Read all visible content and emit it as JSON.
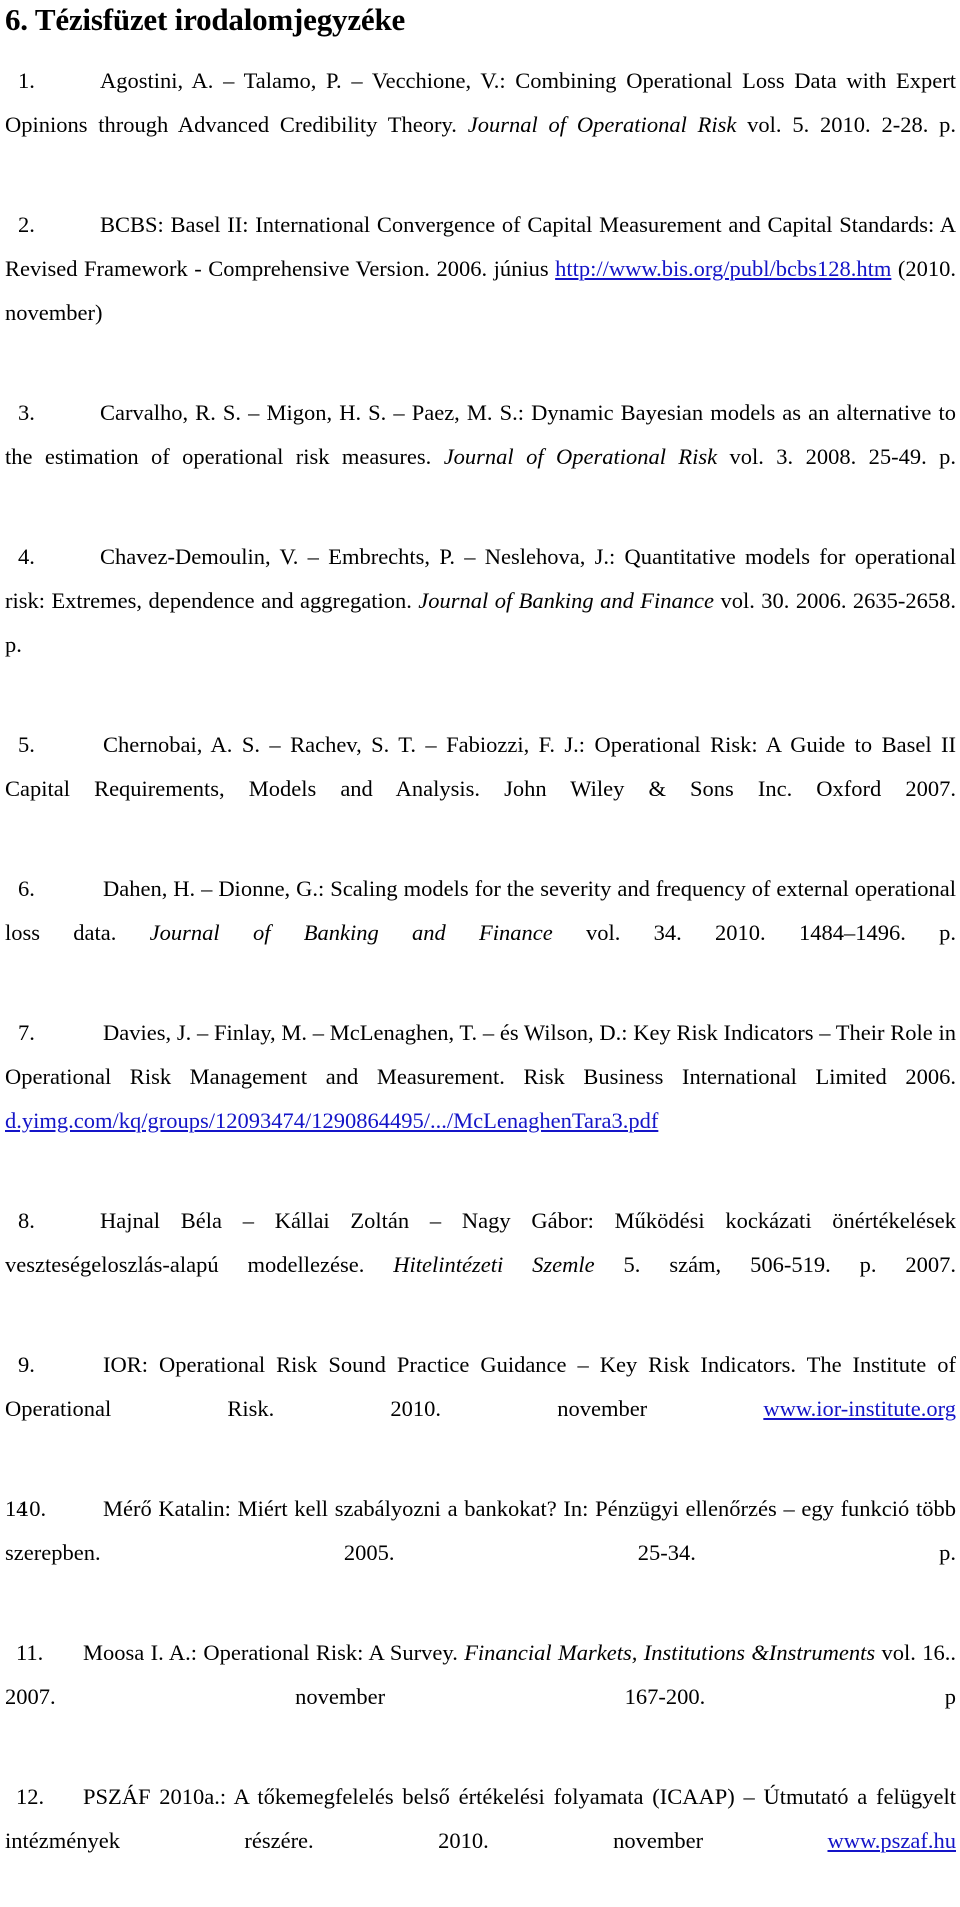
{
  "document": {
    "title": "6. Tézisfüzet irodalomjegyzéke",
    "page_number": "14",
    "link_color": "#1414c8",
    "text_color": "#000000",
    "background_color": "#ffffff"
  },
  "references": [
    {
      "marker": "1.",
      "parts": [
        {
          "type": "text",
          "text": "Agostini, A. – Talamo, P. – Vecchione, V.: Combining Operational Loss Data with Expert Opinions through Advanced Credibility Theory. "
        },
        {
          "type": "italic",
          "text": "Journal of Operational Risk"
        },
        {
          "type": "text",
          "text": " vol. 5. 2010. 2-28. p."
        }
      ],
      "plain": "Agostini, A. – Talamo, P. – Vecchione, V.: Combining Operational Loss Data with Expert Opinions through Advanced Credibility Theory. Journal of Operational Risk vol. 5. 2010. 2-28. p."
    },
    {
      "marker": "2.",
      "parts": [
        {
          "type": "text",
          "text": "BCBS: Basel II: International Convergence of Capital Measurement and Capital Standards: A Revised Framework - Comprehensive Version. 2006. június "
        },
        {
          "type": "link",
          "text": "http://www.bis.org/publ/bcbs128.htm"
        },
        {
          "type": "text",
          "text": " (2010. november)"
        }
      ],
      "plain": "BCBS: Basel II: International Convergence of Capital Measurement and Capital Standards: A Revised Framework - Comprehensive Version. 2006. június http://www.bis.org/publ/bcbs128.htm (2010. november)"
    },
    {
      "marker": "3.",
      "parts": [
        {
          "type": "text",
          "text": "Carvalho, R. S. – Migon, H. S. – Paez, M. S.: Dynamic Bayesian models as an alternative to the estimation of operational risk measures. "
        },
        {
          "type": "italic",
          "text": "Journal of Operational Risk"
        },
        {
          "type": "text",
          "text": " vol. 3. 2008. 25-49. p."
        }
      ],
      "plain": "Carvalho, R. S. – Migon, H. S. – Paez, M. S.: Dynamic Bayesian models as an alternative to the estimation of operational risk measures. Journal of Operational Risk vol. 3. 2008. 25-49. p."
    },
    {
      "marker": "4.",
      "parts": [
        {
          "type": "text",
          "text": "Chavez-Demoulin, V. – Embrechts, P. – Neslehova, J.: Quantitative models for operational risk: Extremes, dependence and aggregation.  "
        },
        {
          "type": "italic",
          "text": "Journal of Banking and Finance"
        },
        {
          "type": "text",
          "text": " vol. 30. 2006. 2635-2658. p."
        }
      ],
      "plain": "Chavez-Demoulin, V. – Embrechts, P. – Neslehova, J.: Quantitative models for operational risk: Extremes, dependence and aggregation. Journal of Banking and Finance vol. 30. 2006. 2635-2658. p."
    },
    {
      "marker": "5.",
      "parts": [
        {
          "type": "text",
          "text": "Chernobai, A. S. – Rachev, S. T. – Fabiozzi, F. J.: Operational Risk: A Guide to Basel II Capital Requirements, Models and Analysis. John Wiley & Sons Inc. Oxford 2007."
        }
      ],
      "plain": "Chernobai, A. S. – Rachev, S. T. – Fabiozzi, F. J.: Operational Risk: A Guide to Basel II Capital Requirements, Models and Analysis. John Wiley & Sons Inc. Oxford 2007."
    },
    {
      "marker": "6.",
      "parts": [
        {
          "type": "text",
          "text": "Dahen, H. – Dionne, G.: Scaling models for the severity and frequency of external operational loss data. "
        },
        {
          "type": "italic",
          "text": "Journal of Banking and Finance"
        },
        {
          "type": "text",
          "text": " vol. 34. 2010. 1484–1496. p."
        }
      ],
      "plain": "Dahen, H. – Dionne, G.: Scaling models for the severity and frequency of external operational loss data. Journal of Banking and Finance vol. 34. 2010. 1484–1496. p."
    },
    {
      "marker": "7.",
      "parts": [
        {
          "type": "text",
          "text": "Davies, J. – Finlay, M. – McLenaghen, T. – és Wilson, D.: Key Risk Indicators – Their Role in Operational Risk Management and Measurement. Risk Business International Limited 2006. "
        },
        {
          "type": "link",
          "text": "d.yimg.com/kq/groups/12093474/1290864495/.../McLenaghenTara3.pdf"
        }
      ],
      "plain": "Davies, J. – Finlay, M. – McLenaghen, T. – és Wilson, D.: Key Risk Indicators – Their Role in Operational Risk Management and Measurement. Risk Business International Limited 2006. d.yimg.com/kq/groups/12093474/1290864495/.../McLenaghenTara3.pdf"
    },
    {
      "marker": "8.",
      "parts": [
        {
          "type": "text",
          "text": "Hajnal Béla – Kállai Zoltán – Nagy Gábor: Működési kockázati önértékelések veszteségeloszlás-alapú modellezése. "
        },
        {
          "type": "italic",
          "text": "Hitelintézeti Szemle"
        },
        {
          "type": "text",
          "text": " 5. szám, 506-519. p. 2007."
        }
      ],
      "plain": "Hajnal Béla – Kállai Zoltán – Nagy Gábor: Működési kockázati önértékelések veszteségeloszlás-alapú modellezése. Hitelintézeti Szemle 5. szám, 506-519. p. 2007."
    },
    {
      "marker": "9.",
      "parts": [
        {
          "type": "text",
          "text": "IOR: Operational Risk Sound Practice Guidance – Key Risk Indicators. The Institute of Operational Risk. 2010. november "
        },
        {
          "type": "link",
          "text": "www.ior-institute.org"
        }
      ],
      "plain": "IOR: Operational Risk Sound Practice Guidance – Key Risk Indicators. The Institute of Operational Risk. 2010. november www.ior-institute.org"
    },
    {
      "marker": "10.",
      "parts": [
        {
          "type": "text",
          "text": "Mérő Katalin: Miért kell szabályozni a bankokat? In: Pénzügyi ellenőrzés – egy funkció több szerepben. 2005. 25-34. p."
        }
      ],
      "plain": "Mérő Katalin: Miért kell szabályozni a bankokat? In: Pénzügyi ellenőrzés – egy funkció több szerepben. 2005. 25-34. p."
    },
    {
      "marker": "11.",
      "parts": [
        {
          "type": "text",
          "text": "Moosa I. A.: Operational Risk: A Survey. "
        },
        {
          "type": "italic",
          "text": "Financial Markets, Institutions &Instruments"
        },
        {
          "type": "text",
          "text": " vol. 16.. 2007. november 167-200. p"
        }
      ],
      "plain": "Moosa I. A.: Operational Risk: A Survey. Financial Markets, Institutions &Instruments vol. 16.. 2007. november 167-200. p"
    },
    {
      "marker": "12.",
      "parts": [
        {
          "type": "text",
          "text": "PSZÁF 2010a.: A tőkemegfelelés belső értékelési folyamata (ICAAP) – Útmutató a felügyelt intézmények részére. 2010. november "
        },
        {
          "type": "link",
          "text": "www.pszaf.hu"
        }
      ],
      "plain": "PSZÁF 2010a.: A tőkemegfelelés belső értékelési folyamata (ICAAP) – Útmutató a felügyelt intézmények részére. 2010. november www.pszaf.hu"
    }
  ]
}
